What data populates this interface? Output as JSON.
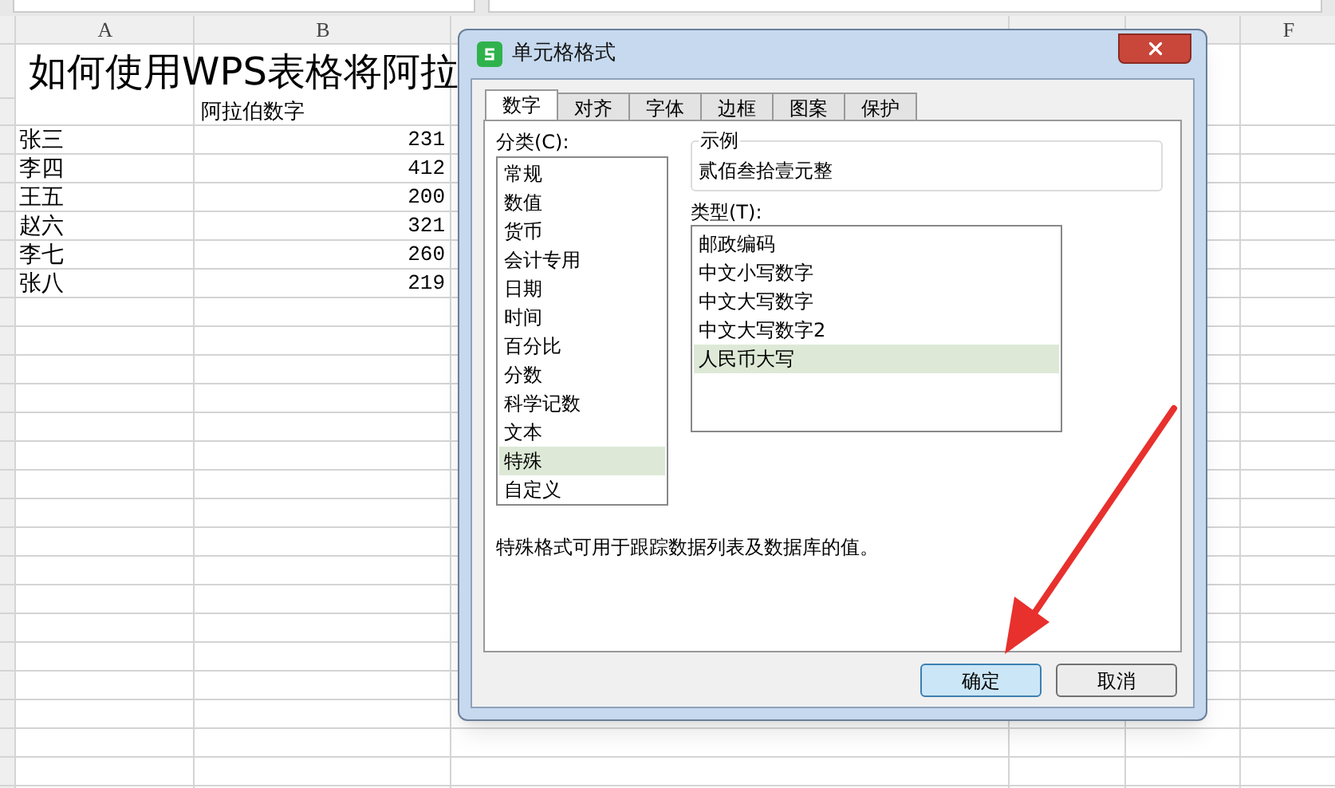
{
  "sheet": {
    "column_headers": [
      {
        "label": "A"
      },
      {
        "label": "B"
      },
      {
        "label": "F"
      }
    ],
    "title_cell": "如何使用WPS表格将阿拉",
    "header_cell": "阿拉伯数字",
    "rows": [
      {
        "name": "张三",
        "value": "231"
      },
      {
        "name": "李四",
        "value": "412"
      },
      {
        "name": "王五",
        "value": "200"
      },
      {
        "name": "赵六",
        "value": "321"
      },
      {
        "name": "李七",
        "value": "260"
      },
      {
        "name": "张八",
        "value": "219"
      }
    ]
  },
  "dialog": {
    "title": "单元格格式",
    "tabs": [
      {
        "label": "数字",
        "selected": true
      },
      {
        "label": "对齐",
        "selected": false
      },
      {
        "label": "字体",
        "selected": false
      },
      {
        "label": "边框",
        "selected": false
      },
      {
        "label": "图案",
        "selected": false
      },
      {
        "label": "保护",
        "selected": false
      }
    ],
    "category_label": "分类(C):",
    "categories": [
      {
        "label": "常规",
        "selected": false
      },
      {
        "label": "数值",
        "selected": false
      },
      {
        "label": "货币",
        "selected": false
      },
      {
        "label": "会计专用",
        "selected": false
      },
      {
        "label": "日期",
        "selected": false
      },
      {
        "label": "时间",
        "selected": false
      },
      {
        "label": "百分比",
        "selected": false
      },
      {
        "label": "分数",
        "selected": false
      },
      {
        "label": "科学记数",
        "selected": false
      },
      {
        "label": "文本",
        "selected": false
      },
      {
        "label": "特殊",
        "selected": true
      },
      {
        "label": "自定义",
        "selected": false
      }
    ],
    "sample_label": "示例",
    "sample_value": "贰佰叁拾壹元整",
    "type_label": "类型(T):",
    "types": [
      {
        "label": "邮政编码",
        "selected": false
      },
      {
        "label": "中文小写数字",
        "selected": false
      },
      {
        "label": "中文大写数字",
        "selected": false
      },
      {
        "label": "中文大写数字2",
        "selected": false
      },
      {
        "label": "人民币大写",
        "selected": true
      }
    ],
    "description": "特殊格式可用于跟踪数据列表及数据库的值。",
    "buttons": [
      {
        "label": "确定",
        "default": true
      },
      {
        "label": "取消",
        "default": false
      }
    ]
  }
}
